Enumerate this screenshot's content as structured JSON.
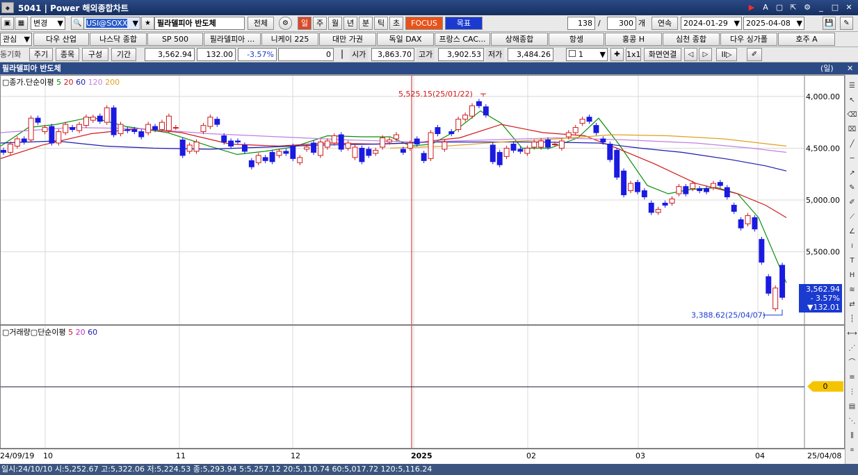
{
  "window": {
    "screen_no": "5041",
    "title": "Power 해외종합차트"
  },
  "toolbar1": {
    "change_label": "변경",
    "symbol_code": "USI@SOXX",
    "symbol_name": "필라델피아 반도체",
    "all_label": "전체",
    "periods": [
      "일",
      "주",
      "월",
      "년",
      "분",
      "틱",
      "초"
    ],
    "focus_label": "FOCUS",
    "target_label": "목표",
    "count_value": "138",
    "count_total": "300",
    "count_unit": "개",
    "continuous_label": "연속",
    "date_from": "2024-01-29",
    "date_to": "2025-04-08"
  },
  "toolbar2": {
    "interest_label": "관심",
    "indices": [
      "다우 산업",
      "나스닥 종합",
      "SP 500",
      "필라델피아 ...",
      "니케이 225",
      "대만 가권",
      "독일 DAX",
      "프랑스 CAC...",
      "상해종합",
      "항셍",
      "홍콩 H",
      "심천 종합",
      "다우 싱가폴",
      "호주 A"
    ]
  },
  "toolbar3": {
    "sync_label": "동기화",
    "period_label": "주기",
    "item_label": "종목",
    "compose_label": "구성",
    "term_label": "기간",
    "price": "3,562.94",
    "change": "132.00",
    "change_pct": "-3.57%",
    "volume": "0",
    "open_label": "시가",
    "open": "3,863.70",
    "high_label": "고가",
    "high": "3,902.53",
    "low_label": "저가",
    "low": "3,484.26",
    "chart_count": "1",
    "ratio_label": "1x1",
    "screen_link_label": "화면연결"
  },
  "price_panel": {
    "title": "필라델피아 반도체",
    "period_tag": "(일)",
    "legend_label": "종가.단순이평",
    "legend_periods": [
      "5",
      "20",
      "60",
      "120",
      "200"
    ],
    "legend_colors": [
      "#0a8f0a",
      "#d01818",
      "#1a1ab0",
      "#c080e0",
      "#e0a020"
    ],
    "max_annotation": "5,525.15(25/01/22)",
    "min_annotation": "3,388.62(25/04/07)",
    "price_badge": [
      "3,562.94",
      "- 3.57%",
      "▼132.01"
    ],
    "y_ticks": [
      "5,500.00",
      "5,000.00",
      "4,500.00",
      "4,000.00"
    ]
  },
  "volume_panel": {
    "legend_label": "거래량",
    "ma_label": "단순이평",
    "ma_periods": [
      "5",
      "20",
      "60"
    ],
    "zero_badge": "0"
  },
  "x_axis": {
    "labels": [
      "24/09/19",
      "10",
      "11",
      "12",
      "2025",
      "02",
      "03",
      "04",
      "25/04/08"
    ]
  },
  "status": {
    "text": "일시:24/10/10 시:5,252.67 고:5,322.06 저:5,224.53 종:5,293.94 5:5,257.12 20:5,110.74 60:5,017.72 120:5,116.24"
  },
  "chart_data": {
    "type": "candlestick",
    "title": "필라델피아 반도체",
    "ylim": [
      3300,
      5700
    ],
    "y_ticks": [
      4000,
      4500,
      5000,
      5500
    ],
    "x_labels": [
      "24/09/19",
      "10",
      "11",
      "12",
      "2025",
      "02",
      "03",
      "04",
      "25/04/08"
    ],
    "candles": [
      {
        "o": 4980,
        "c": 4960
      },
      {
        "o": 4960,
        "c": 5040
      },
      {
        "o": 5020,
        "c": 5090
      },
      {
        "o": 5090,
        "c": 5060
      },
      {
        "o": 5080,
        "c": 5290
      },
      {
        "o": 5290,
        "c": 5250
      },
      {
        "o": 5160,
        "c": 5200
      },
      {
        "o": 5210,
        "c": 5050
      },
      {
        "o": 5050,
        "c": 5160
      },
      {
        "o": 5150,
        "c": 5230
      },
      {
        "o": 5200,
        "c": 5180
      },
      {
        "o": 5170,
        "c": 5230
      },
      {
        "o": 5220,
        "c": 5300
      },
      {
        "o": 5270,
        "c": 5300
      },
      {
        "o": 5310,
        "c": 5260
      },
      {
        "o": 5250,
        "c": 5390
      },
      {
        "o": 5390,
        "c": 5130
      },
      {
        "o": 5140,
        "c": 5230
      },
      {
        "o": 5180,
        "c": 5170
      },
      {
        "o": 5180,
        "c": 5160
      },
      {
        "o": 5160,
        "c": 5110
      },
      {
        "o": 5150,
        "c": 5230
      },
      {
        "o": 5210,
        "c": 5180
      },
      {
        "o": 5180,
        "c": 5250
      },
      {
        "o": 5170,
        "c": 5310
      },
      {
        "o": 5200,
        "c": 5200
      },
      {
        "o": 5080,
        "c": 4930
      },
      {
        "o": 4970,
        "c": 5030
      },
      {
        "o": 4970,
        "c": 5060
      },
      {
        "o": 5160,
        "c": 5220
      },
      {
        "o": 5210,
        "c": 5300
      },
      {
        "o": 5280,
        "c": 5230
      },
      {
        "o": 5120,
        "c": 5060
      },
      {
        "o": 5070,
        "c": 5020
      },
      {
        "o": 5070,
        "c": 5060
      },
      {
        "o": 5030,
        "c": 4970
      },
      {
        "o": 4880,
        "c": 4820
      },
      {
        "o": 4860,
        "c": 4930
      },
      {
        "o": 4910,
        "c": 4880
      },
      {
        "o": 4960,
        "c": 4870
      },
      {
        "o": 4930,
        "c": 4970
      },
      {
        "o": 4970,
        "c": 4950
      },
      {
        "o": 5020,
        "c": 4900
      },
      {
        "o": 4860,
        "c": 4910
      },
      {
        "o": 4990,
        "c": 5010
      },
      {
        "o": 5050,
        "c": 4960
      },
      {
        "o": 4930,
        "c": 5060
      },
      {
        "o": 5010,
        "c": 5070
      },
      {
        "o": 5050,
        "c": 5120
      },
      {
        "o": 5130,
        "c": 4990
      },
      {
        "o": 5000,
        "c": 5050
      },
      {
        "o": 4910,
        "c": 5010
      },
      {
        "o": 5000,
        "c": 4870
      },
      {
        "o": 4990,
        "c": 4930
      },
      {
        "o": 4950,
        "c": 4980
      },
      {
        "o": 5010,
        "c": 5100
      },
      {
        "o": 5060,
        "c": 5080
      },
      {
        "o": 5090,
        "c": 5130
      },
      {
        "o": 4990,
        "c": 4960
      },
      {
        "o": 5000,
        "c": 5050
      },
      {
        "o": 5090,
        "c": 5040
      },
      {
        "o": 4950,
        "c": 4880
      },
      {
        "o": 4900,
        "c": 5150
      },
      {
        "o": 5200,
        "c": 5140
      },
      {
        "o": 4990,
        "c": 5060
      },
      {
        "o": 5160,
        "c": 5140
      },
      {
        "o": 5180,
        "c": 5280
      },
      {
        "o": 5280,
        "c": 5320
      },
      {
        "o": 5310,
        "c": 5410
      },
      {
        "o": 5450,
        "c": 5410
      },
      {
        "o": 5400,
        "c": 5320
      },
      {
        "o": 5030,
        "c": 4870
      },
      {
        "o": 4960,
        "c": 4840
      },
      {
        "o": 4920,
        "c": 5000
      },
      {
        "o": 5040,
        "c": 4980
      },
      {
        "o": 4990,
        "c": 4970
      },
      {
        "o": 4950,
        "c": 5000
      },
      {
        "o": 5010,
        "c": 5060
      },
      {
        "o": 5010,
        "c": 5070
      },
      {
        "o": 5080,
        "c": 5010
      },
      {
        "o": 5040,
        "c": 5040
      },
      {
        "o": 5000,
        "c": 5070
      },
      {
        "o": 5110,
        "c": 5150
      },
      {
        "o": 5150,
        "c": 5200
      },
      {
        "o": 5240,
        "c": 5280
      },
      {
        "o": 5300,
        "c": 5260
      },
      {
        "o": 5220,
        "c": 5150
      },
      {
        "o": 5090,
        "c": 5060
      },
      {
        "o": 5040,
        "c": 4890
      },
      {
        "o": 4980,
        "c": 4720
      },
      {
        "o": 4780,
        "c": 4550
      },
      {
        "o": 4590,
        "c": 4660
      },
      {
        "o": 4670,
        "c": 4580
      },
      {
        "o": 4590,
        "c": 4530
      },
      {
        "o": 4470,
        "c": 4380
      },
      {
        "o": 4380,
        "c": 4410
      },
      {
        "o": 4470,
        "c": 4450
      },
      {
        "o": 4470,
        "c": 4510
      },
      {
        "o": 4560,
        "c": 4630
      },
      {
        "o": 4630,
        "c": 4560
      },
      {
        "o": 4610,
        "c": 4660
      },
      {
        "o": 4610,
        "c": 4590
      },
      {
        "o": 4610,
        "c": 4580
      },
      {
        "o": 4620,
        "c": 4660
      },
      {
        "o": 4670,
        "c": 4640
      },
      {
        "o": 4620,
        "c": 4530
      },
      {
        "o": 4450,
        "c": 4390
      },
      {
        "o": 4310,
        "c": 4230
      },
      {
        "o": 4270,
        "c": 4350
      },
      {
        "o": 4330,
        "c": 4220
      },
      {
        "o": 4120,
        "c": 3900
      },
      {
        "o": 3760,
        "c": 3600
      },
      {
        "o": 3450,
        "c": 3650
      },
      {
        "o": 3870,
        "c": 3560
      }
    ],
    "ma_series": [
      {
        "name": "5",
        "color": "#0a8f0a",
        "values": [
          [
            0,
            5020
          ],
          [
            40,
            5200
          ],
          [
            80,
            5230
          ],
          [
            130,
            5300
          ],
          [
            180,
            5210
          ],
          [
            240,
            5150
          ],
          [
            300,
            5020
          ],
          [
            340,
            4940
          ],
          [
            380,
            4970
          ],
          [
            420,
            5010
          ],
          [
            470,
            5120
          ],
          [
            520,
            5110
          ],
          [
            560,
            5110
          ],
          [
            590,
            5020
          ],
          [
            620,
            5040
          ],
          [
            650,
            5150
          ],
          [
            690,
            5360
          ],
          [
            720,
            5240
          ],
          [
            750,
            5000
          ],
          [
            790,
            5000
          ],
          [
            830,
            5100
          ],
          [
            860,
            5290
          ],
          [
            890,
            5030
          ],
          [
            930,
            4640
          ],
          [
            960,
            4560
          ],
          [
            990,
            4600
          ],
          [
            1030,
            4620
          ],
          [
            1060,
            4560
          ],
          [
            1090,
            4330
          ],
          [
            1130,
            3700
          ]
        ]
      },
      {
        "name": "20",
        "color": "#d01818",
        "values": [
          [
            0,
            4900
          ],
          [
            60,
            5030
          ],
          [
            130,
            5140
          ],
          [
            200,
            5190
          ],
          [
            260,
            5150
          ],
          [
            330,
            5040
          ],
          [
            400,
            5020
          ],
          [
            470,
            5050
          ],
          [
            540,
            5040
          ],
          [
            590,
            5050
          ],
          [
            660,
            5100
          ],
          [
            720,
            5230
          ],
          [
            780,
            5150
          ],
          [
            840,
            5120
          ],
          [
            890,
            4990
          ],
          [
            940,
            4850
          ],
          [
            1000,
            4660
          ],
          [
            1060,
            4560
          ],
          [
            1100,
            4450
          ],
          [
            1130,
            4330
          ]
        ]
      },
      {
        "name": "60",
        "color": "#1a1ab0",
        "values": [
          [
            0,
            5050
          ],
          [
            80,
            5070
          ],
          [
            150,
            5020
          ],
          [
            220,
            5000
          ],
          [
            300,
            4990
          ],
          [
            380,
            5010
          ],
          [
            460,
            5030
          ],
          [
            540,
            5040
          ],
          [
            620,
            5060
          ],
          [
            700,
            5060
          ],
          [
            780,
            5060
          ],
          [
            860,
            5050
          ],
          [
            920,
            5000
          ],
          [
            980,
            4960
          ],
          [
            1050,
            4890
          ],
          [
            1100,
            4830
          ],
          [
            1130,
            4780
          ]
        ]
      },
      {
        "name": "120",
        "color": "#c080e0",
        "values": [
          [
            0,
            5150
          ],
          [
            100,
            5200
          ],
          [
            200,
            5190
          ],
          [
            300,
            5140
          ],
          [
            400,
            5110
          ],
          [
            500,
            5080
          ],
          [
            600,
            5060
          ],
          [
            700,
            5080
          ],
          [
            800,
            5100
          ],
          [
            900,
            5080
          ],
          [
            1000,
            5050
          ],
          [
            1080,
            5000
          ],
          [
            1130,
            4960
          ]
        ]
      },
      {
        "name": "200",
        "color": "#e0a020",
        "values": [
          [
            560,
            5000
          ],
          [
            640,
            5020
          ],
          [
            720,
            5060
          ],
          [
            800,
            5090
          ],
          [
            880,
            5130
          ],
          [
            960,
            5120
          ],
          [
            1040,
            5090
          ],
          [
            1130,
            5020
          ]
        ]
      }
    ]
  }
}
